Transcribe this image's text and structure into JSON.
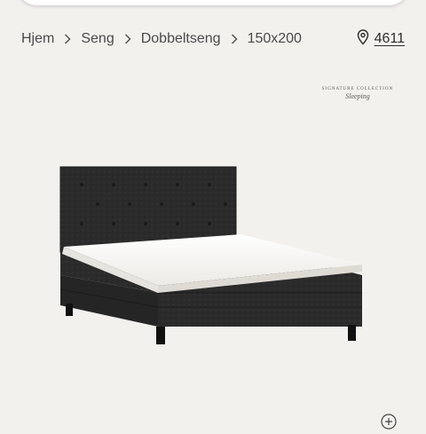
{
  "breadcrumb": {
    "items": [
      {
        "label": "Hjem"
      },
      {
        "label": "Seng"
      },
      {
        "label": "Dobbeltseng"
      },
      {
        "label": "150x200"
      }
    ],
    "separator_icon": "chevron-right-icon"
  },
  "store": {
    "icon": "location-pin-icon",
    "label": "4611"
  },
  "brand": {
    "collection": "SIGNATURE COLLECTION",
    "script": "Sleeping"
  },
  "product_image": {
    "subject": "black tufted boxspring bed with white mattress topper"
  },
  "controls": {
    "zoom_icon": "zoom-in-icon"
  },
  "colors": {
    "background": "#f3f1ee",
    "text": "#4a4a4a",
    "bed_fabric": "#2a2a2a",
    "mattress": "#f8f8f6"
  }
}
